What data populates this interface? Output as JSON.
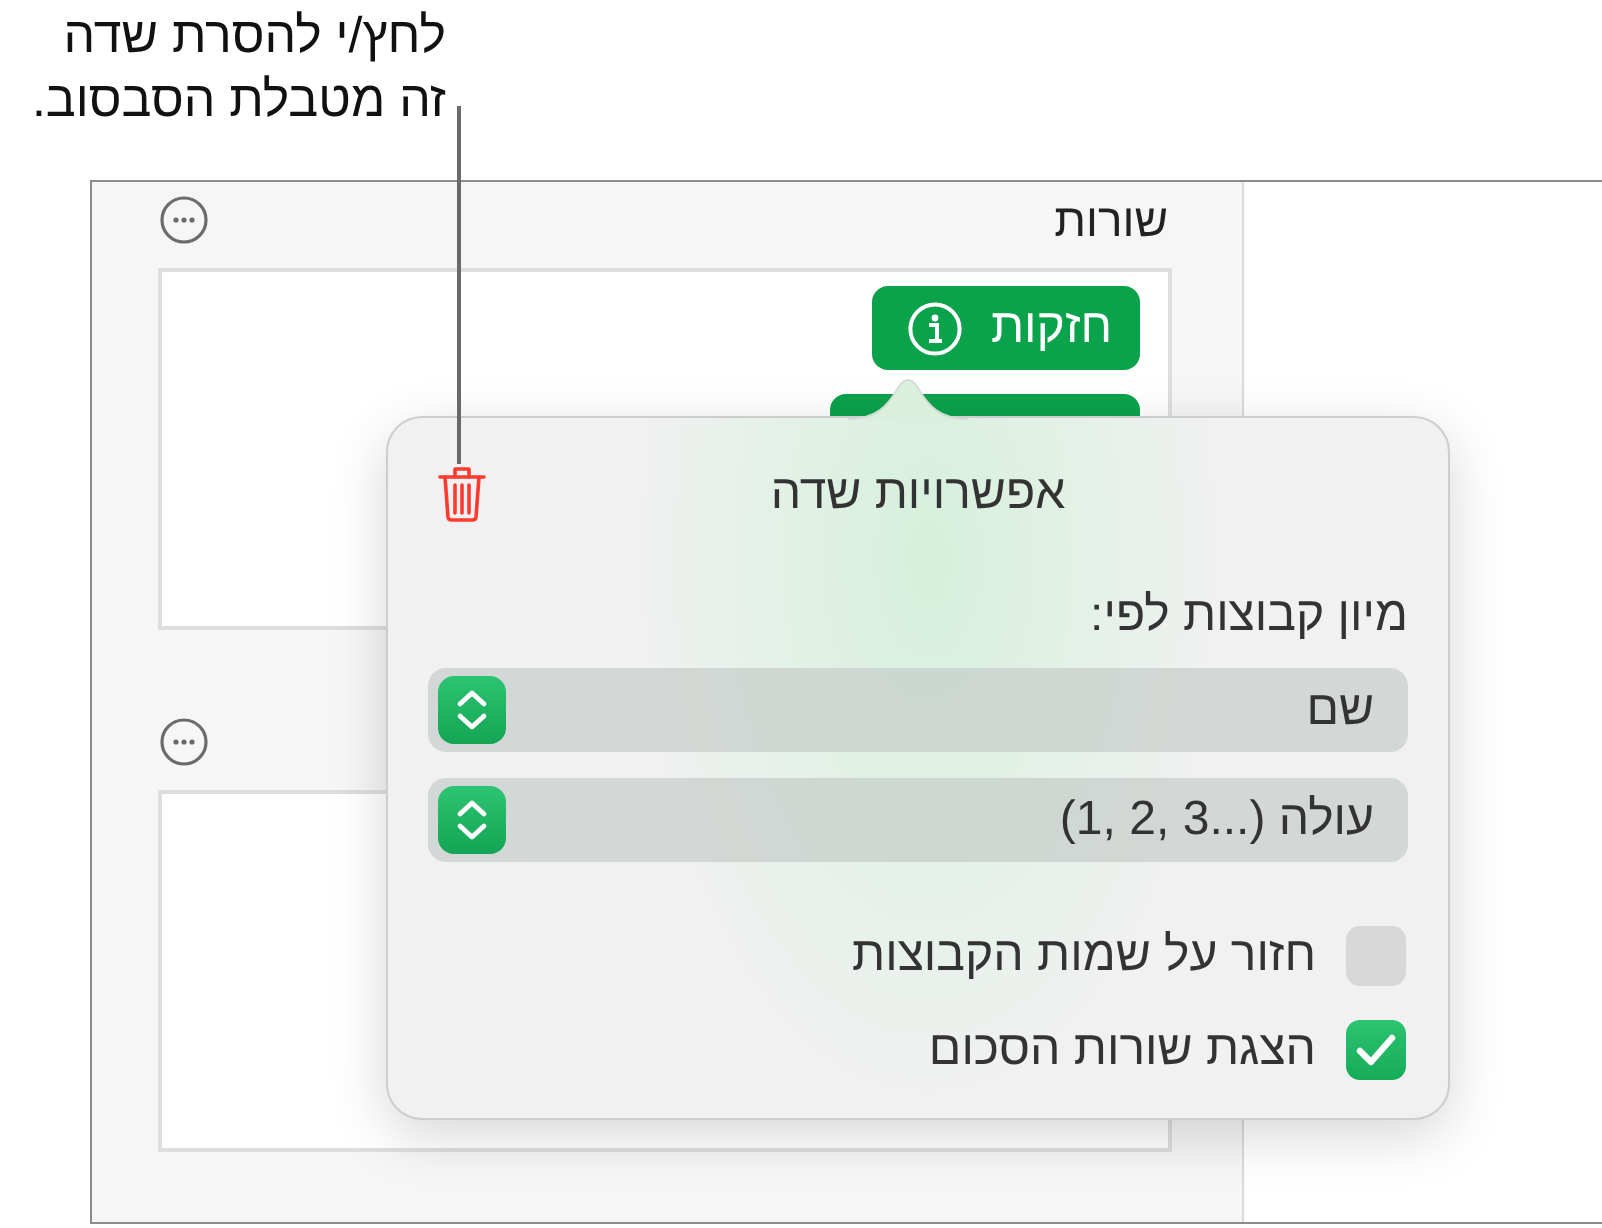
{
  "callout": {
    "text": "לחץ/י להסרת שדה\nזה מטבלת הסבסוב."
  },
  "panel": {
    "sections": [
      {
        "title": "שורות",
        "menu_button": true,
        "fields": [
          {
            "kind": "labeled",
            "label": "חזקות"
          },
          {
            "kind": "covered"
          }
        ]
      },
      {
        "menu_button": true
      }
    ]
  },
  "popover": {
    "title": "אפשרויות שדה",
    "sort_label": "מיון קבוצות לפי:",
    "menus": [
      {
        "value": "שם"
      },
      {
        "value": "עולה (...3 ,2 ,1)"
      }
    ],
    "options": [
      {
        "label": "חזור על שמות הקבוצות",
        "checked": false
      },
      {
        "label": "הצגת שורות הסכום",
        "checked": true
      }
    ]
  }
}
